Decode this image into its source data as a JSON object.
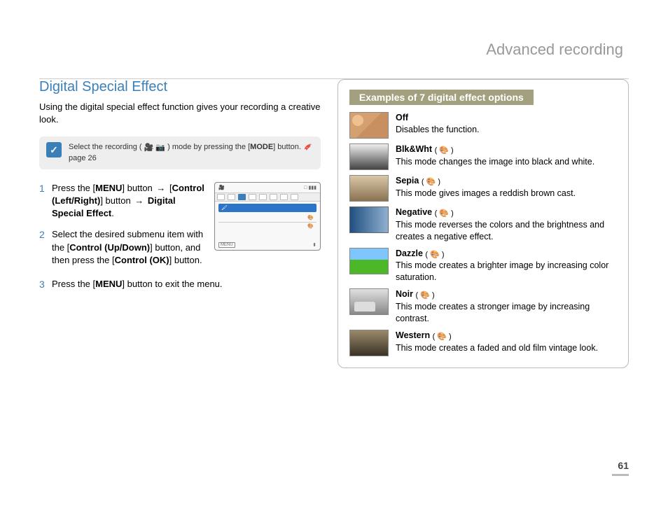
{
  "header": {
    "chapter_title": "Advanced recording"
  },
  "section": {
    "title": "Digital Special Effect",
    "intro": "Using the digital special effect function gives your recording a creative look."
  },
  "note": {
    "pre": "Select the recording (",
    "post": ") mode by pressing the [",
    "button_label": "MODE",
    "tail": "] button. ",
    "ref": "page 26"
  },
  "steps": [
    {
      "num": "1",
      "parts": {
        "a": "Press the [",
        "b": "MENU",
        "c": "] button ",
        "d": "[",
        "e": "Control (Left/Right)",
        "f": "] button ",
        "g": "Digital Special Effect",
        "h": "."
      }
    },
    {
      "num": "2",
      "parts": {
        "a": "Select the desired submenu item with the [",
        "b": "Control (Up/Down)",
        "c": "] button, and then press the [",
        "d": "Control (OK)",
        "e": "] button."
      }
    },
    {
      "num": "3",
      "parts": {
        "a": "Press the [",
        "b": "MENU",
        "c": "] button to exit the menu."
      }
    }
  ],
  "menu_screen": {
    "bottom_label": "MENU"
  },
  "effects": {
    "header": "Examples of 7 digital effect options",
    "items": [
      {
        "name": "Off",
        "icon": "",
        "desc": "Disables the function."
      },
      {
        "name": "Blk&Wht",
        "icon": "( 🎨 )",
        "desc": "This mode changes the image into black and white."
      },
      {
        "name": "Sepia",
        "icon": "( 🎨 )",
        "desc": "This mode gives images a reddish brown cast."
      },
      {
        "name": "Negative",
        "icon": "( 🎨 )",
        "desc": "This mode reverses the colors and the brightness and creates a negative effect."
      },
      {
        "name": "Dazzle",
        "icon": "( 🎨 )",
        "desc": "This mode creates a brighter image by increasing color saturation."
      },
      {
        "name": "Noir",
        "icon": "( 🎨 )",
        "desc": "This mode creates a stronger image by increasing contrast."
      },
      {
        "name": "Western",
        "icon": "( 🎨 )",
        "desc": "This mode creates a faded and old film vintage look."
      }
    ]
  },
  "page_number": "61"
}
